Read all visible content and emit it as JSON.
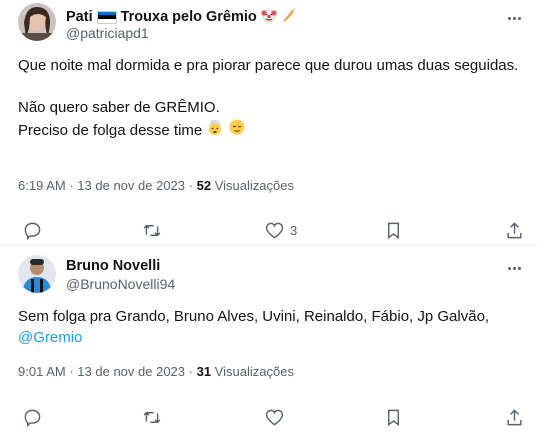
{
  "tweets": [
    {
      "display_name": "Pati",
      "name_suffix": "Trouxa pelo Grêmio",
      "name_emojis": [
        "estonia-flag",
        "clown-face",
        "rocket"
      ],
      "handle": "@patriciapd1",
      "lines": [
        "Que noite mal dormida e pra piorar parece que durou umas  duas seguidas.",
        "",
        "Não quero saber de GRÊMIO.",
        "Preciso de folga desse time"
      ],
      "line_emojis": [
        "exploding-head",
        "relieved-face"
      ],
      "time": "6:19 AM",
      "date": "13 de nov de 2023",
      "views_count": "52",
      "views_label": "Visualizações",
      "likes": "3",
      "colors": {
        "flag_blue": "#0072ce",
        "flag_black": "#000000",
        "flag_white": "#ffffff"
      }
    },
    {
      "display_name": "Bruno Novelli",
      "handle": "@BrunoNovelli94",
      "text": "Sem folga pra Grando, Bruno Alves, Uvini, Reinaldo, Fábio, Jp Galvão,",
      "mention": "@Gremio",
      "time": "9:01 AM",
      "date": "13 de nov de 2023",
      "views_count": "31",
      "views_label": "Visualizações"
    }
  ],
  "separator": "·",
  "colors": {
    "text": "#0f1419",
    "secondary": "#536471",
    "link": "#1d9bf0"
  }
}
